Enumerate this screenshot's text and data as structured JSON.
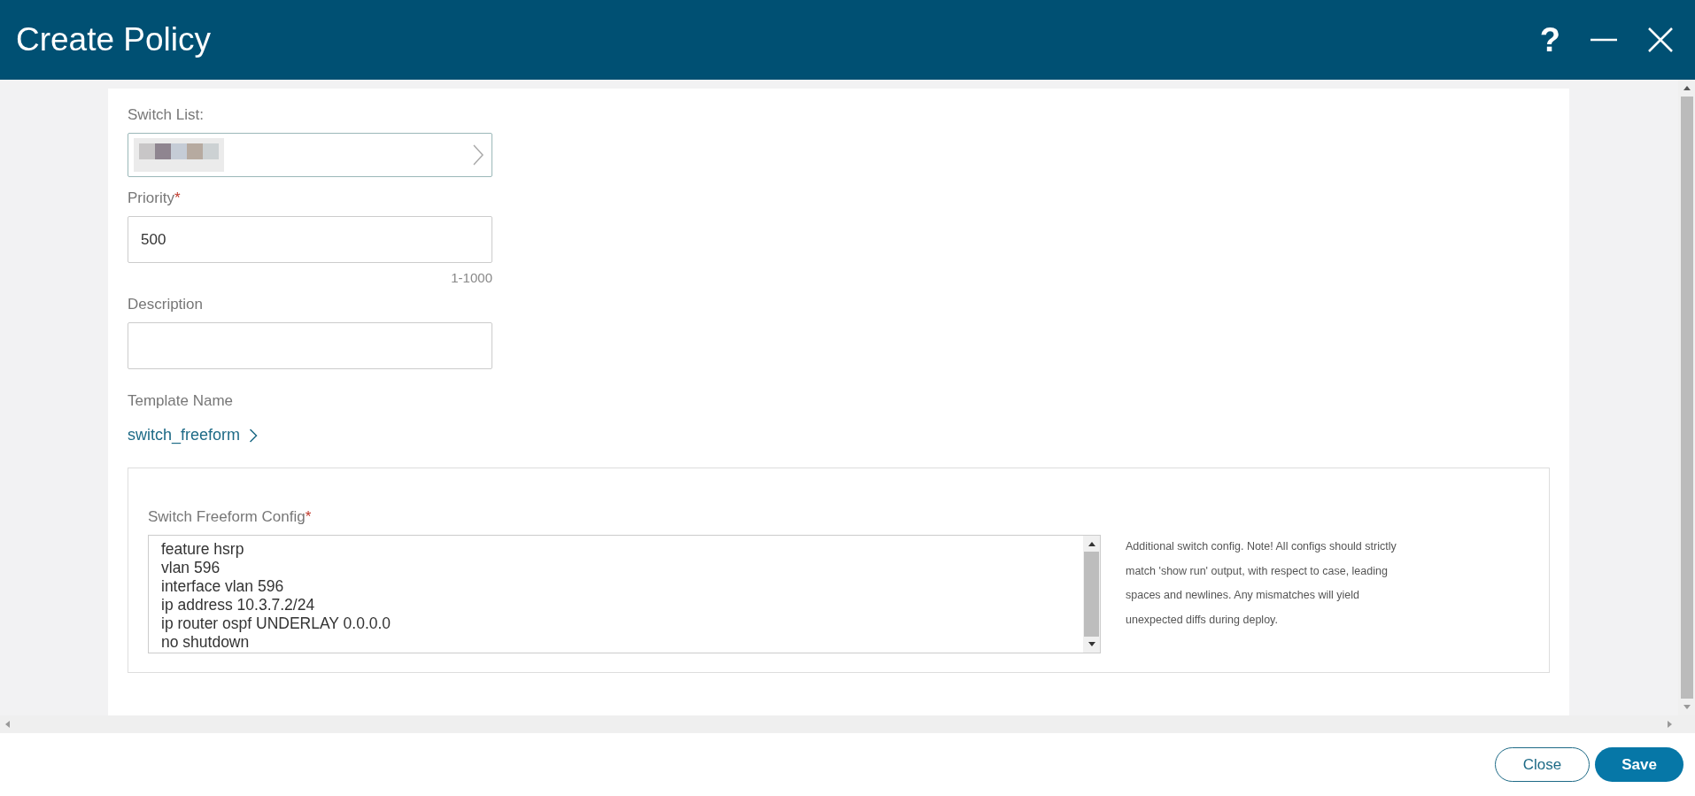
{
  "window": {
    "title": "Create Policy",
    "help_glyph": "?"
  },
  "fields": [
    {
      "kind": "select",
      "label": "Switch List:",
      "value_redacted": true
    },
    {
      "kind": "input",
      "label": "Priority",
      "required_mark": "*",
      "value": "500",
      "hint": "1-1000"
    },
    {
      "kind": "input",
      "label": "Description"
    },
    {
      "kind": "link",
      "label": "Template Name",
      "value": "switch_freeform"
    }
  ],
  "config": {
    "label": "Switch Freeform Config",
    "required_mark": "*",
    "lines": [
      "feature hsrp",
      "vlan 596",
      "interface vlan 596",
      "ip address 10.3.7.2/24",
      "ip router ospf UNDERLAY 0.0.0.0",
      "no shutdown"
    ],
    "help": "Additional switch config. Note! All configs should strictly match 'show run' output, with respect to case, leading spaces and newlines. Any mismatches will yield unexpected diffs during deploy."
  },
  "buttons": [
    {
      "label": "Close",
      "kind": "secondary"
    },
    {
      "label": "Save",
      "kind": "primary"
    }
  ]
}
